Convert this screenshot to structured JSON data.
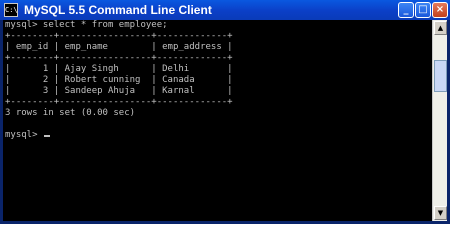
{
  "window": {
    "title": "MySQL 5.5 Command Line Client",
    "icon_label": "C:\\",
    "controls": {
      "minimize": "_",
      "maximize": "□",
      "close": "×"
    }
  },
  "console": {
    "lines": [
      "mysql> select * from employee;",
      "+--------+-----------------+-------------+",
      "| emp_id | emp_name        | emp_address |",
      "+--------+-----------------+-------------+",
      "|      1 | Ajay Singh      | Delhi       |",
      "|      2 | Robert cunning  | Canada      |",
      "|      3 | Sandeep Ahuja   | Karnal      |",
      "+--------+-----------------+-------------+",
      "3 rows in set (0.00 sec)",
      "",
      "mysql> "
    ]
  },
  "scrollbar": {
    "up_arrow": "▲",
    "down_arrow": "▼"
  }
}
